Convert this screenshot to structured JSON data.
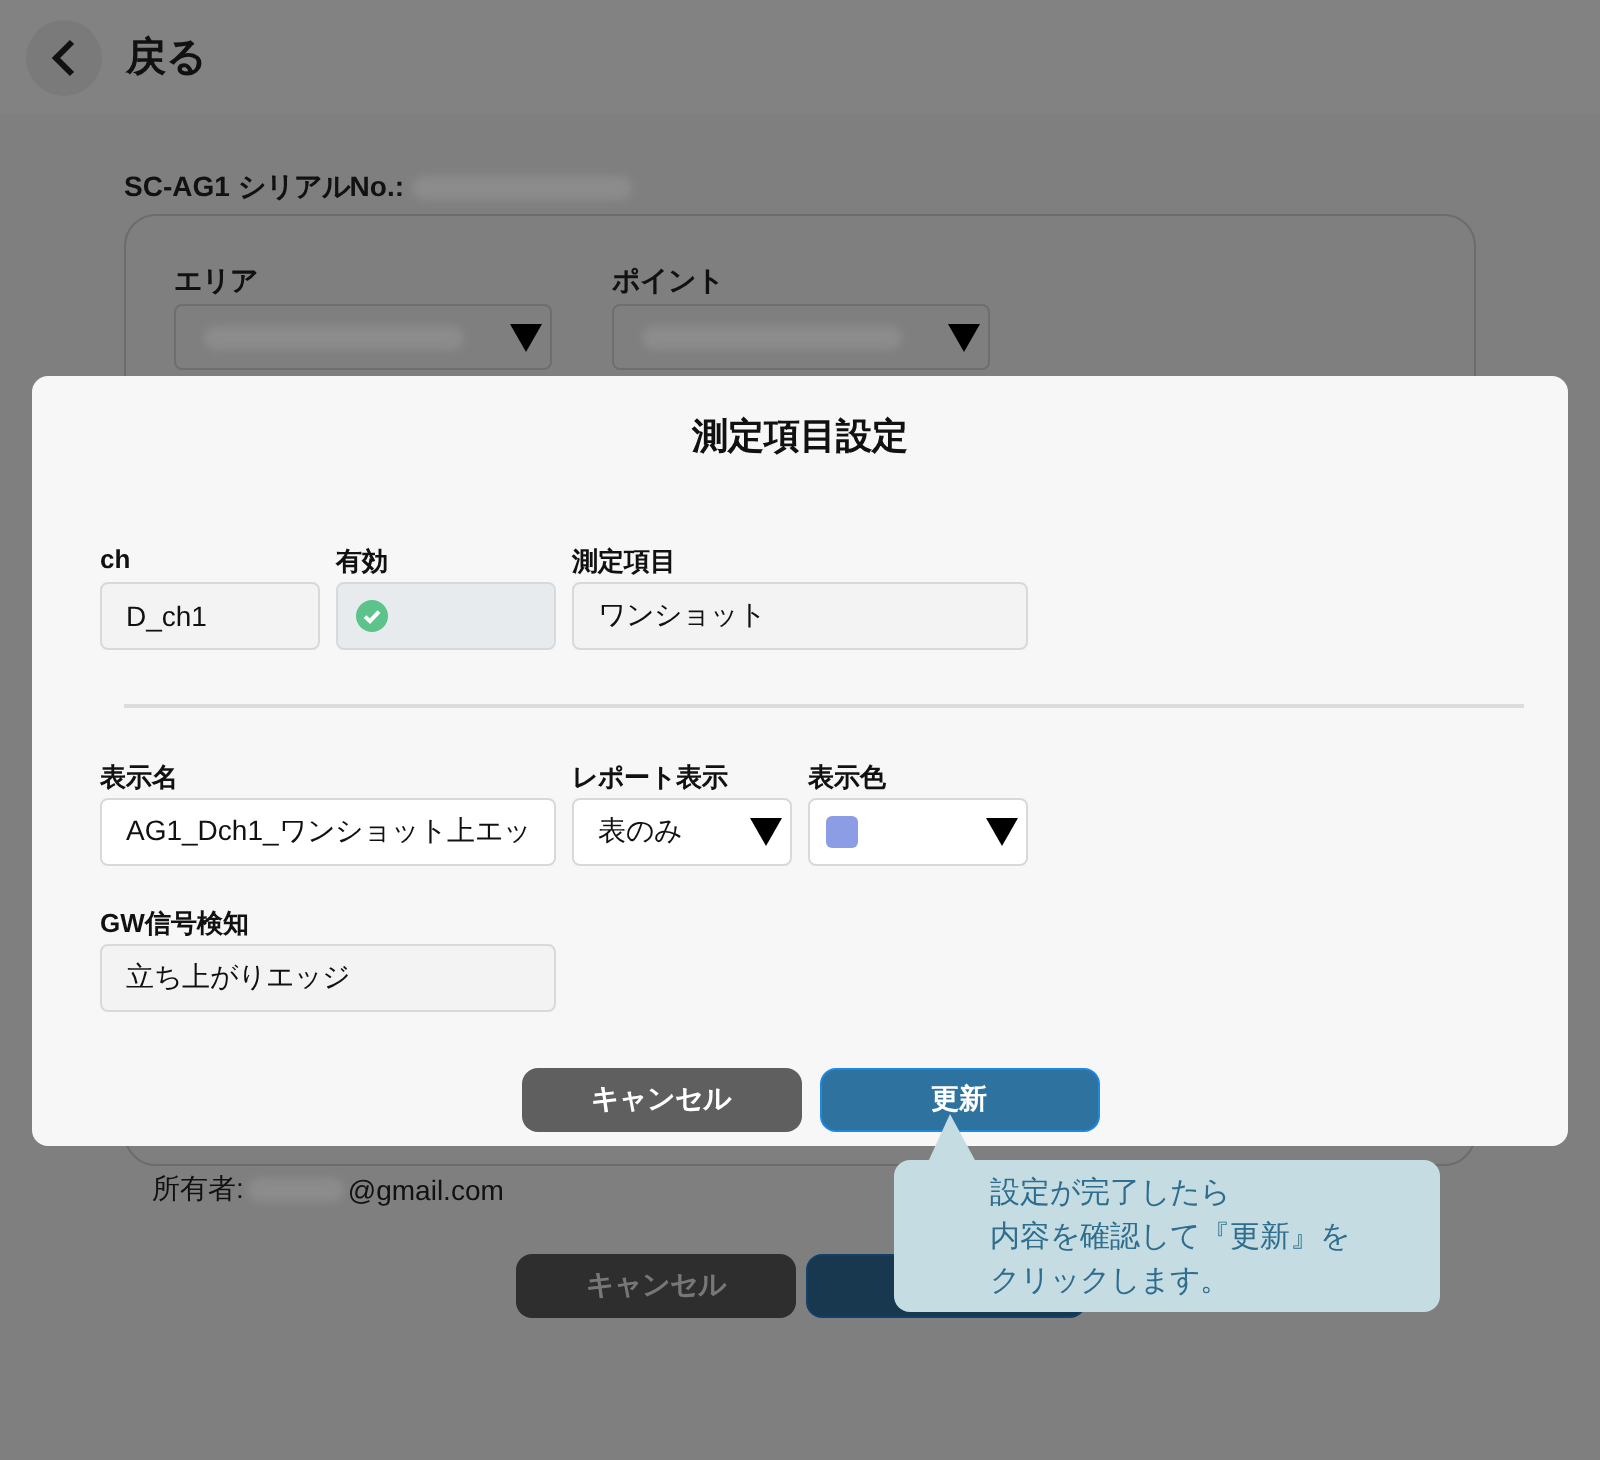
{
  "header": {
    "back_label": "戻る"
  },
  "background_form": {
    "serial_label": "SC-AG1 シリアルNo.:",
    "fields": [
      {
        "label": "エリア"
      },
      {
        "label": "ポイント"
      }
    ],
    "owner_label": "所有者:",
    "owner_suffix": "@gmail.com",
    "buttons": [
      {
        "kind": "cancel",
        "label": "キャンセル"
      },
      {
        "kind": "primary"
      }
    ]
  },
  "dialog": {
    "title": "測定項目設定",
    "sections": [
      {
        "fields": [
          {
            "kind": "text",
            "label": "ch",
            "value": "D_ch1",
            "disabled": true,
            "wide": false
          },
          {
            "kind": "check",
            "label": "有効",
            "checked": true,
            "wide": false
          },
          {
            "kind": "text",
            "label": "測定項目",
            "value": "ワンショット",
            "disabled": true,
            "wide": true
          }
        ]
      },
      {
        "fields": [
          {
            "kind": "text",
            "label": "表示名",
            "value": "AG1_Dch1_ワンショット上エッ",
            "disabled": false,
            "wide": true
          },
          {
            "kind": "select",
            "label": "レポート表示",
            "value": "表のみ",
            "wide": false
          },
          {
            "kind": "color",
            "label": "表示色",
            "color": "#8c9de6",
            "wide": false
          },
          {
            "kind": "text",
            "label": "GW信号検知",
            "value": "立ち上がりエッジ",
            "disabled": true,
            "wide": true
          }
        ]
      }
    ],
    "buttons": [
      {
        "kind": "cancel",
        "label": "キャンセル"
      },
      {
        "kind": "primary",
        "label": "更新"
      }
    ]
  },
  "tooltip": {
    "lines": [
      "設定が完了したら",
      "内容を確認して『更新』を",
      "クリックします。"
    ]
  }
}
